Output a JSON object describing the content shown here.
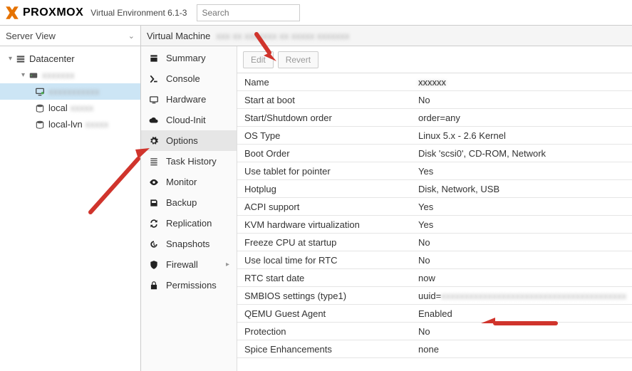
{
  "header": {
    "logo_text": "PROXMOX",
    "version": "Virtual Environment 6.1-3",
    "search_placeholder": "Search"
  },
  "leftpane": {
    "view": "Server View",
    "tree": {
      "datacenter": "Datacenter",
      "node": "xxxxxxx",
      "vm": "xxxxxxxxxxx",
      "local_prefix": "local",
      "local_suffix": "xxxxx",
      "local_lvn_prefix": "local-lvn",
      "local_lvn_suffix": "xxxxx"
    }
  },
  "vm": {
    "title_prefix": "Virtual Machine",
    "title_blur": "xxx xx xxxxxxx xx xxxxx xxxxxxx"
  },
  "tabs": {
    "summary": "Summary",
    "console": "Console",
    "hardware": "Hardware",
    "cloudinit": "Cloud-Init",
    "options": "Options",
    "taskhistory": "Task History",
    "monitor": "Monitor",
    "backup": "Backup",
    "replication": "Replication",
    "snapshots": "Snapshots",
    "firewall": "Firewall",
    "permissions": "Permissions"
  },
  "toolbar": {
    "edit": "Edit",
    "revert": "Revert"
  },
  "options": [
    {
      "k": "Name",
      "v": "xxxxxx",
      "blur": true
    },
    {
      "k": "Start at boot",
      "v": "No"
    },
    {
      "k": "Start/Shutdown order",
      "v": "order=any"
    },
    {
      "k": "OS Type",
      "v": "Linux 5.x - 2.6 Kernel"
    },
    {
      "k": "Boot Order",
      "v": "Disk 'scsi0', CD-ROM, Network"
    },
    {
      "k": "Use tablet for pointer",
      "v": "Yes"
    },
    {
      "k": "Hotplug",
      "v": "Disk, Network, USB"
    },
    {
      "k": "ACPI support",
      "v": "Yes"
    },
    {
      "k": "KVM hardware virtualization",
      "v": "Yes"
    },
    {
      "k": "Freeze CPU at startup",
      "v": "No"
    },
    {
      "k": "Use local time for RTC",
      "v": "No"
    },
    {
      "k": "RTC start date",
      "v": "now"
    },
    {
      "k": "SMBIOS settings (type1)",
      "v_prefix": "uuid=",
      "v_blur": "xxxxxxxxxxxxxxxxxxxxxxxxxxxxxxxxxxxxxxxx"
    },
    {
      "k": "QEMU Guest Agent",
      "v": "Enabled"
    },
    {
      "k": "Protection",
      "v": "No"
    },
    {
      "k": "Spice Enhancements",
      "v": "none"
    }
  ]
}
